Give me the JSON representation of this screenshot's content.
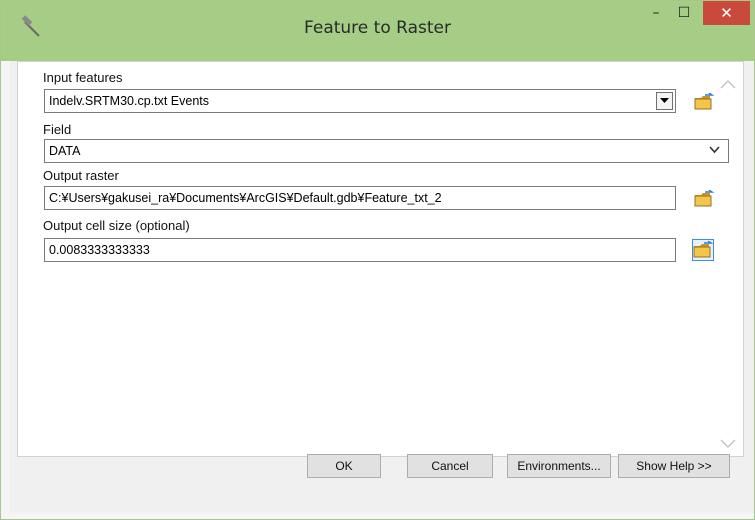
{
  "window": {
    "title": "Feature to Raster",
    "minimize": "–",
    "maximize": "☐",
    "close": "✕"
  },
  "form": {
    "input_features": {
      "label": "Input features",
      "value": "Indelv.SRTM30.cp.txt Events"
    },
    "field": {
      "label": "Field",
      "value": "DATA"
    },
    "output_raster": {
      "label": "Output raster",
      "value": "C:¥Users¥gakusei_ra¥Documents¥ArcGIS¥Default.gdb¥Feature_txt_2"
    },
    "cell_size": {
      "label": "Output cell size (optional)",
      "value": "0.0083333333333"
    }
  },
  "buttons": {
    "ok": "OK",
    "cancel": "Cancel",
    "environments": "Environments...",
    "show_help": "Show Help >>"
  },
  "icons": {
    "title": "hammer-icon",
    "browse": "folder-browse-icon",
    "scroll_up": "scroll-up-chevron-icon",
    "scroll_down": "scroll-down-chevron-icon"
  },
  "colors": {
    "titlebar": "#a6cd86",
    "close_button": "#c94a3d",
    "folder_yellow": "#f2c64a",
    "focus_border": "#3d8ee8"
  }
}
